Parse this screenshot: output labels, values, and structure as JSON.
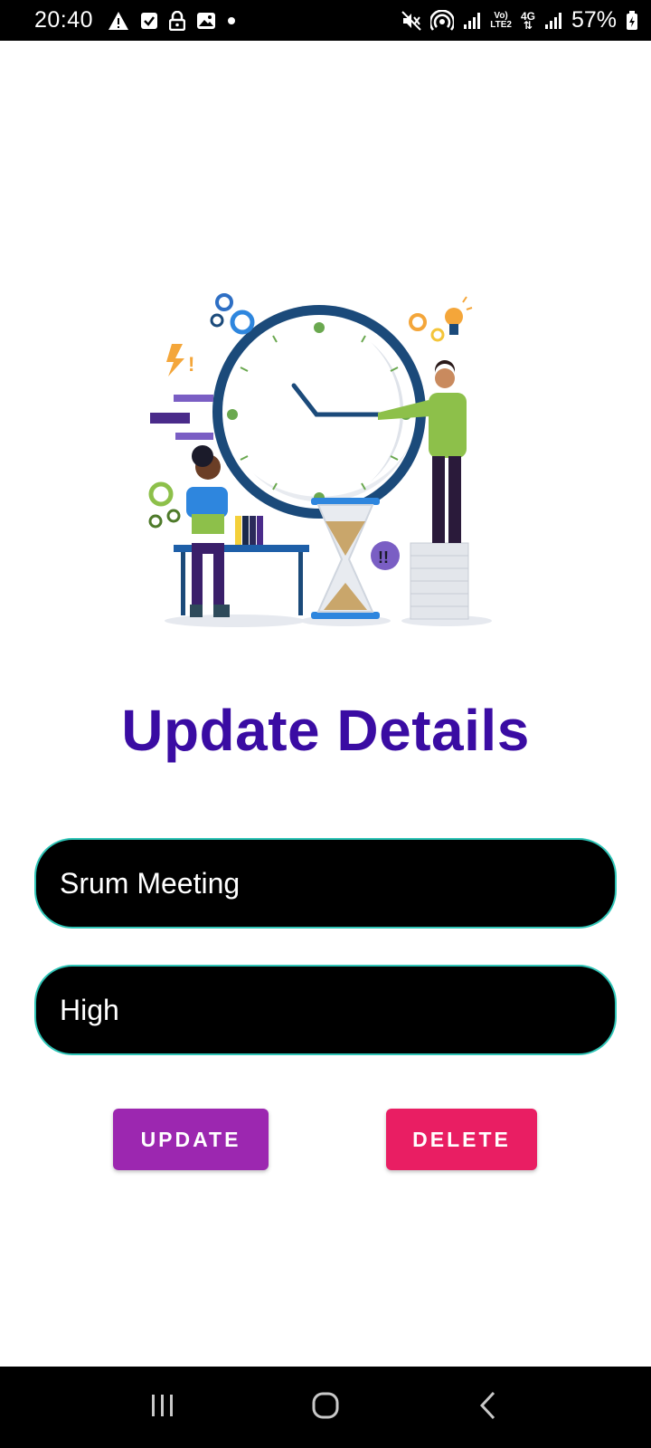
{
  "status_bar": {
    "time": "20:40",
    "battery": "57%",
    "volte_top": "Vo)",
    "volte_bottom": "LTE2",
    "network": "4G",
    "left_icons": [
      "warning-icon",
      "checkbox-icon",
      "lock-icon",
      "image-icon",
      "dot-icon"
    ],
    "right_icons": [
      "mute-icon",
      "hotspot-icon",
      "signal-icon",
      "volte-icon",
      "4g-icon",
      "signal-icon",
      "battery-icon"
    ]
  },
  "illustration": {
    "icon": "time-management-illustration"
  },
  "page": {
    "title": "Update Details"
  },
  "form": {
    "title_value": "Srum Meeting",
    "priority_value": "High"
  },
  "buttons": {
    "update_label": "UPDATE",
    "delete_label": "DELETE"
  },
  "nav": {
    "icons": [
      "recents-icon",
      "home-icon",
      "back-icon"
    ]
  },
  "colors": {
    "title": "#3a0ca3",
    "field_border": "#2ec4b6",
    "update_button": "#9c27b0",
    "delete_button": "#e91e63"
  }
}
